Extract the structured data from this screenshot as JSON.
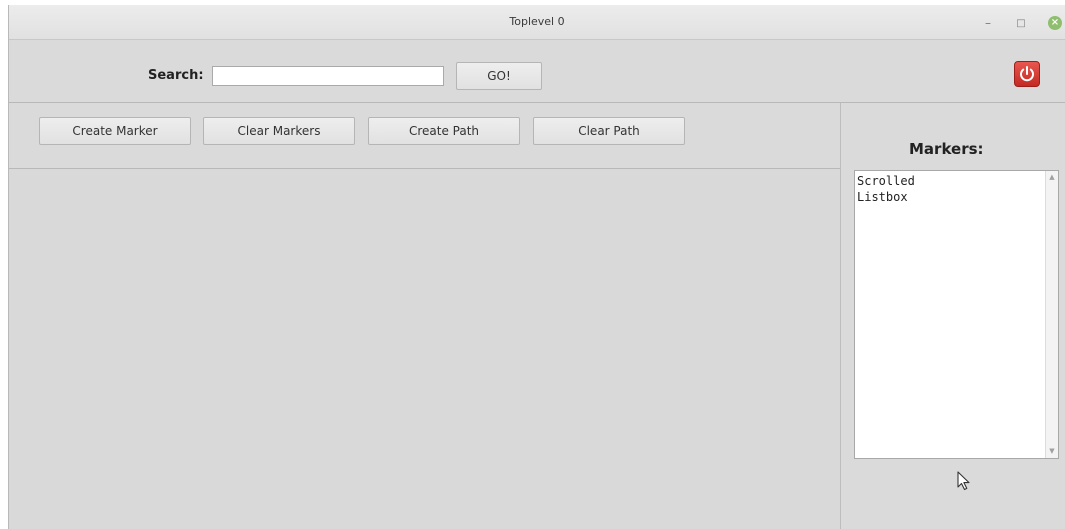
{
  "window": {
    "title": "Toplevel 0",
    "minimize_glyph": "–",
    "maximize_glyph": "□",
    "close_glyph": "×",
    "close_color": "#8fbf6e"
  },
  "search": {
    "label": "Search:",
    "value": "",
    "placeholder": "",
    "go_label": "GO!"
  },
  "power": {
    "icon": "power-icon",
    "color": "#d63b33"
  },
  "actions": {
    "create_marker": "Create Marker",
    "clear_markers": "Clear Markers",
    "create_path": "Create Path",
    "clear_path": "Clear Path"
  },
  "markers": {
    "heading": "Markers:",
    "items": [
      "Scrolled",
      "Listbox"
    ]
  }
}
